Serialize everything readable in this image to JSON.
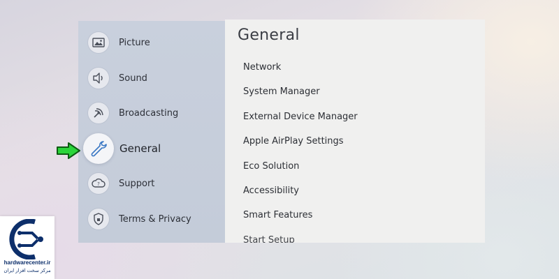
{
  "sidebar": {
    "items": [
      {
        "label": "Picture",
        "icon": "picture-icon"
      },
      {
        "label": "Sound",
        "icon": "sound-icon"
      },
      {
        "label": "Broadcasting",
        "icon": "broadcasting-icon"
      },
      {
        "label": "General",
        "icon": "wrench-icon",
        "active": true
      },
      {
        "label": "Support",
        "icon": "support-icon"
      },
      {
        "label": "Terms & Privacy",
        "icon": "shield-icon"
      }
    ]
  },
  "main": {
    "title": "General",
    "items": [
      "Network",
      "System Manager",
      "External Device Manager",
      "Apple AirPlay Settings",
      "Eco Solution",
      "Accessibility",
      "Smart Features",
      "Start Setup"
    ]
  },
  "watermark": {
    "site": "hardwarecenter.ir",
    "tagline": "مرکز سخت افزار ایران"
  },
  "colors": {
    "pointer_arrow": "#2bd43a",
    "active_icon": "#3b78c4",
    "logo_brand": "#0d2f6b"
  }
}
